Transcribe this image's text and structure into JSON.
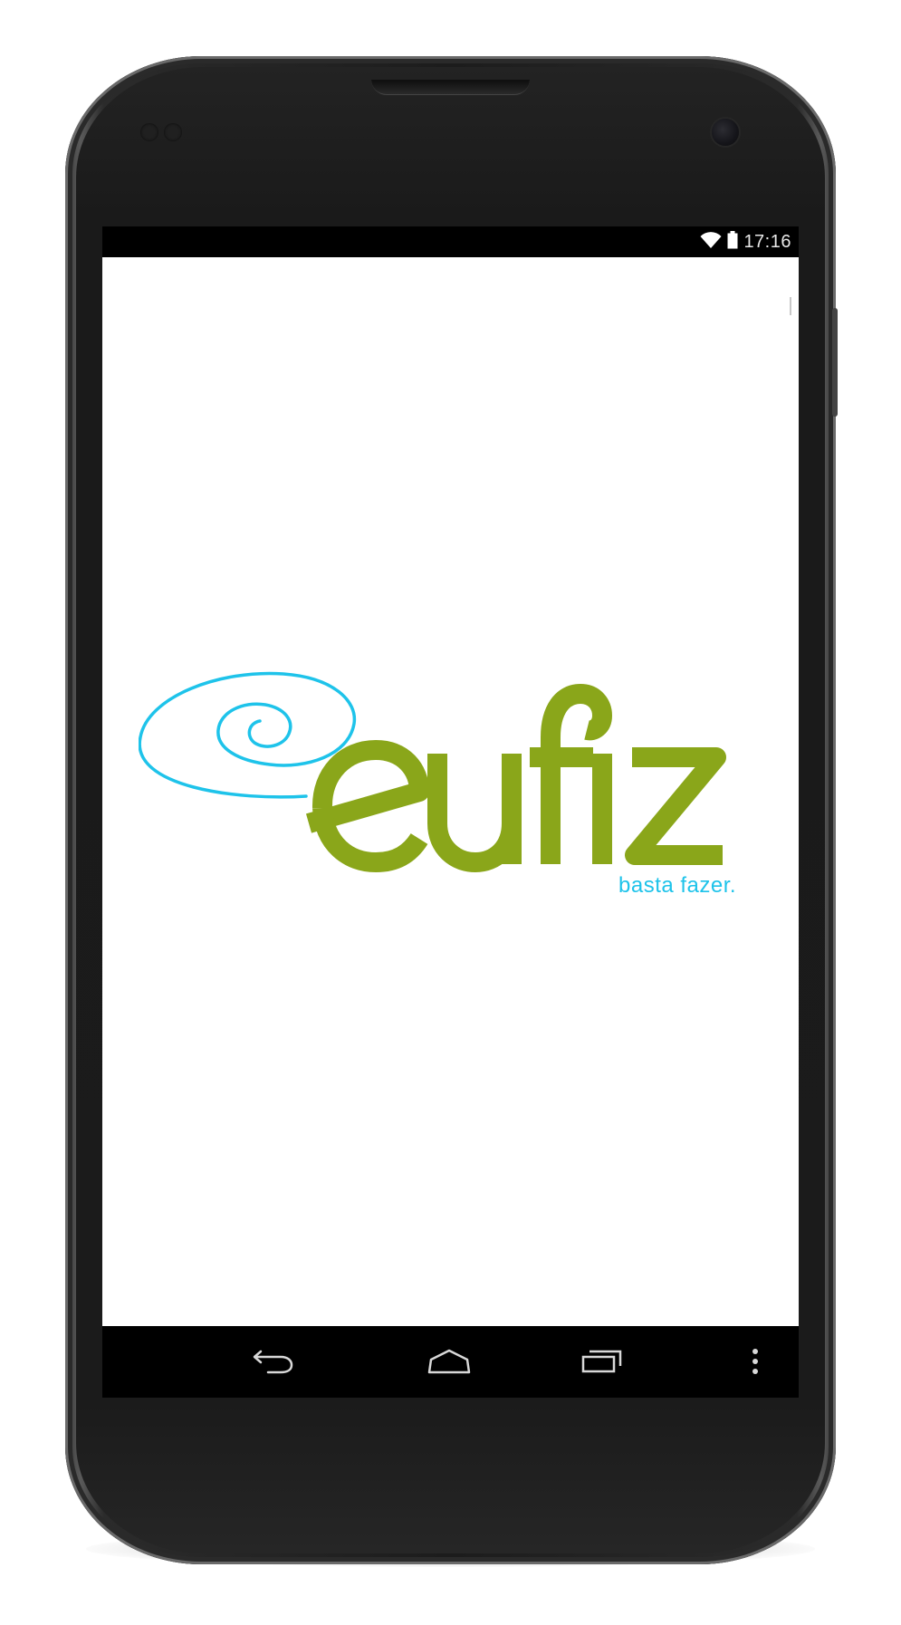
{
  "status_bar": {
    "time": "17:16",
    "wifi_icon": "wifi-icon",
    "battery_icon": "battery-icon"
  },
  "app": {
    "logo_text": "eufiz",
    "tagline": "basta fazer.",
    "colors": {
      "logo_green": "#8aa61a",
      "swirl_blue": "#1ec3ea",
      "tagline_blue": "#1ec3ea"
    }
  },
  "nav_bar": {
    "back_icon": "back-icon",
    "home_icon": "home-icon",
    "recents_icon": "recents-icon",
    "menu_icon": "overflow-menu-icon"
  }
}
